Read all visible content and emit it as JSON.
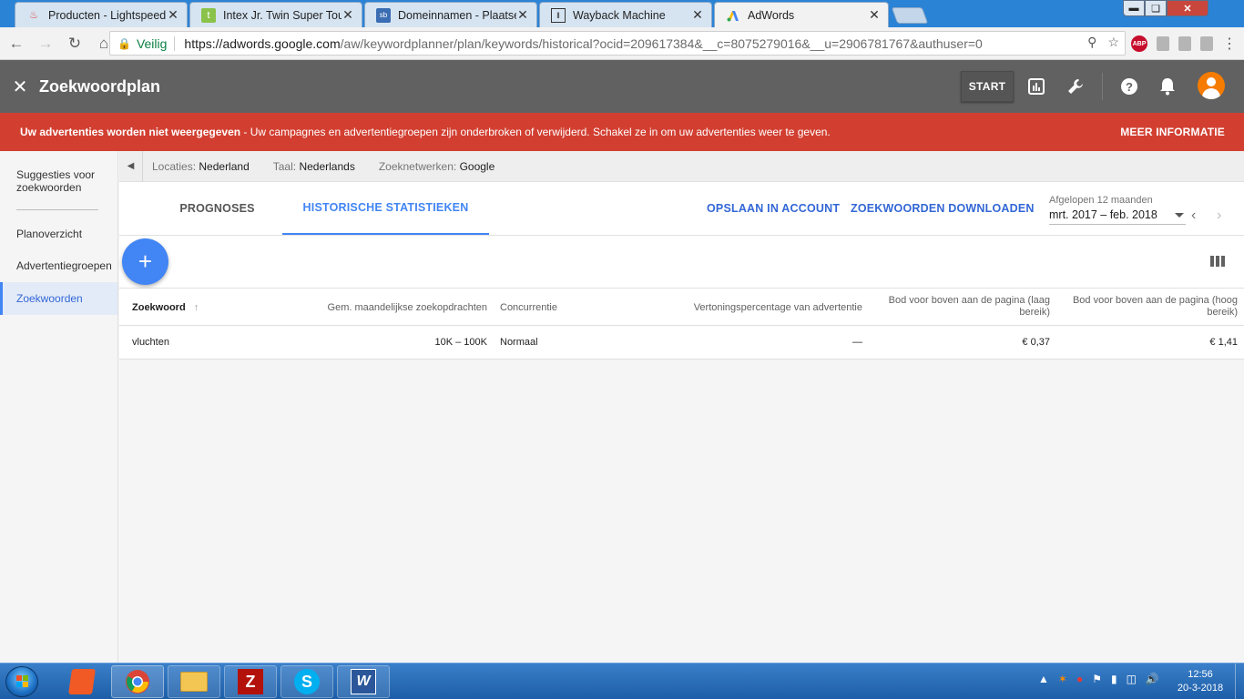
{
  "browser": {
    "tabs": [
      {
        "title": "Producten - Lightspeed e",
        "favicon": "lightspeed-flame-icon",
        "color": "#e3473b"
      },
      {
        "title": "Intex Jr. Twin Super Toug",
        "favicon": "green-t-icon",
        "color": "#8bc34a"
      },
      {
        "title": "Domeinnamen - Plaatser",
        "favicon": "sb-icon",
        "color": "#3b6db3"
      },
      {
        "title": "Wayback Machine",
        "favicon": "archive-icon",
        "color": "#333333"
      },
      {
        "title": "AdWords",
        "favicon": "adwords-icon",
        "color": "#4285f4"
      }
    ],
    "secure_label": "Veilig",
    "url_host": "https://adwords.google.com",
    "url_rest": "/aw/keywordplanner/plan/keywords/historical?ocid=209617384&__c=8075279016&__u=2906781767&authuser=0",
    "abp_label": "ABP"
  },
  "header": {
    "title": "Zoekwoordplan",
    "start_label": "START"
  },
  "alert": {
    "bold": "Uw advertenties worden niet weergegeven",
    "text": " - Uw campagnes en advertentiegroepen zijn onderbroken of verwijderd. Schakel ze in om uw advertenties weer te geven.",
    "more": "MEER INFORMATIE",
    "color": "#d23f31"
  },
  "sidebar": {
    "items": [
      {
        "label": "Suggesties voor zoekwoorden"
      },
      {
        "label": "Planoverzicht"
      },
      {
        "label": "Advertentiegroepen"
      },
      {
        "label": "Zoekwoorden"
      }
    ]
  },
  "filters": [
    {
      "key": "Locaties:",
      "value": "Nederland"
    },
    {
      "key": "Taal:",
      "value": "Nederlands"
    },
    {
      "key": "Zoeknetwerken:",
      "value": "Google"
    }
  ],
  "main": {
    "tabs": [
      {
        "label": "PROGNOSES"
      },
      {
        "label": "HISTORISCHE STATISTIEKEN"
      }
    ],
    "save_label": "OPSLAAN IN ACCOUNT",
    "download_label": "ZOEKWOORDEN DOWNLOADEN",
    "date_label": "Afgelopen 12 maanden",
    "date_value": "mrt. 2017 – feb. 2018",
    "accent": "#4285f4"
  },
  "table": {
    "headers": {
      "keyword": "Zoekwoord",
      "searches": "Gem. maandelijkse zoekopdrachten",
      "competition": "Concurrentie",
      "impression_share": "Vertoningspercentage van advertentie",
      "bid_low": "Bod voor boven aan de pagina (laag bereik)",
      "bid_high": "Bod voor boven aan de pagina (hoog bereik)"
    },
    "rows": [
      {
        "keyword": "vluchten",
        "searches": "10K – 100K",
        "competition": "Normaal",
        "impression_share": "—",
        "bid_low": "€ 0,37",
        "bid_high": "€ 1,41"
      }
    ]
  },
  "taskbar": {
    "time": "12:56",
    "date": "20-3-2018"
  }
}
